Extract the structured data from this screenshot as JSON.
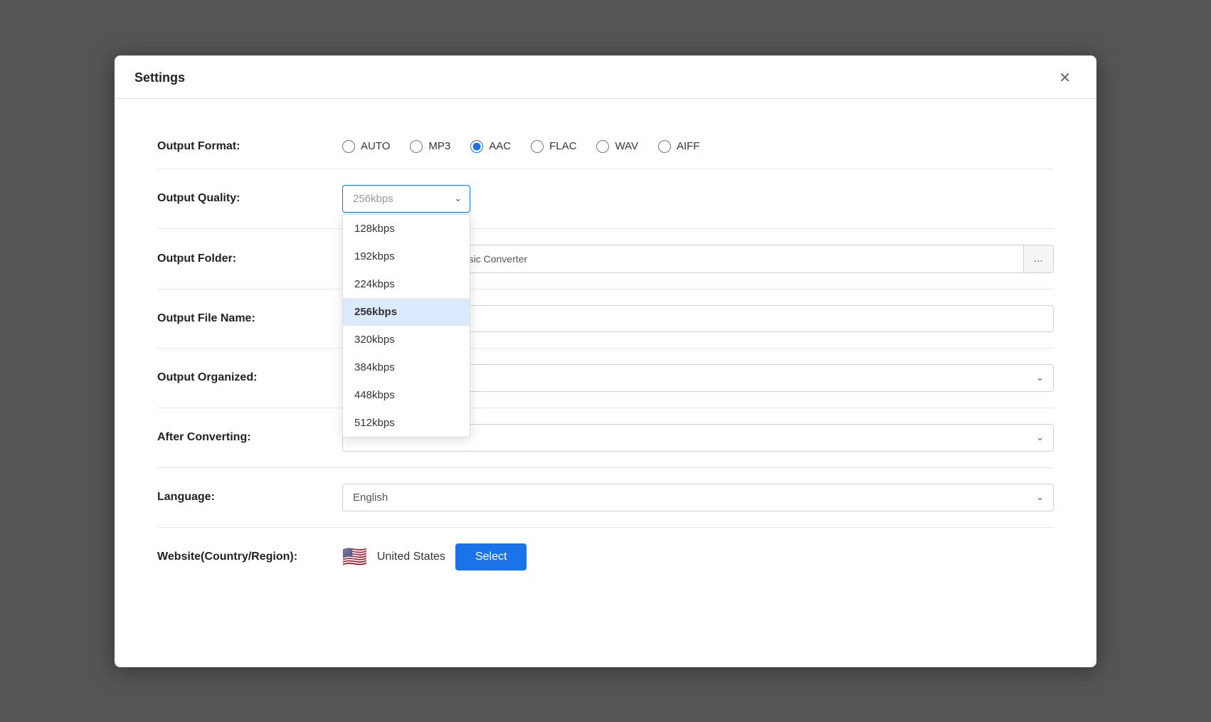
{
  "dialog": {
    "title": "Settings",
    "close_label": "✕"
  },
  "output_format": {
    "label": "Output Format:",
    "options": [
      "AUTO",
      "MP3",
      "AAC",
      "FLAC",
      "WAV",
      "AIFF"
    ],
    "selected": "AAC"
  },
  "output_quality": {
    "label": "Output Quality:",
    "selected": "256kbps",
    "placeholder": "256kbps",
    "options": [
      "128kbps",
      "192kbps",
      "224kbps",
      "256kbps",
      "320kbps",
      "384kbps",
      "448kbps",
      "512kbps"
    ]
  },
  "output_folder": {
    "label": "Output Folder:",
    "path": "ents\\Ukeysoft Amazon Music Converter",
    "browse_label": "..."
  },
  "output_file_name": {
    "label": "Output File Name:",
    "value": ""
  },
  "output_organized": {
    "label": "Output Organized:",
    "value": ""
  },
  "after_converting": {
    "label": "After Converting:",
    "value": ""
  },
  "language": {
    "label": "Language:",
    "value": "English"
  },
  "website": {
    "label": "Website(Country/Region):",
    "country": "United States",
    "flag": "🇺🇸",
    "select_label": "Select"
  }
}
